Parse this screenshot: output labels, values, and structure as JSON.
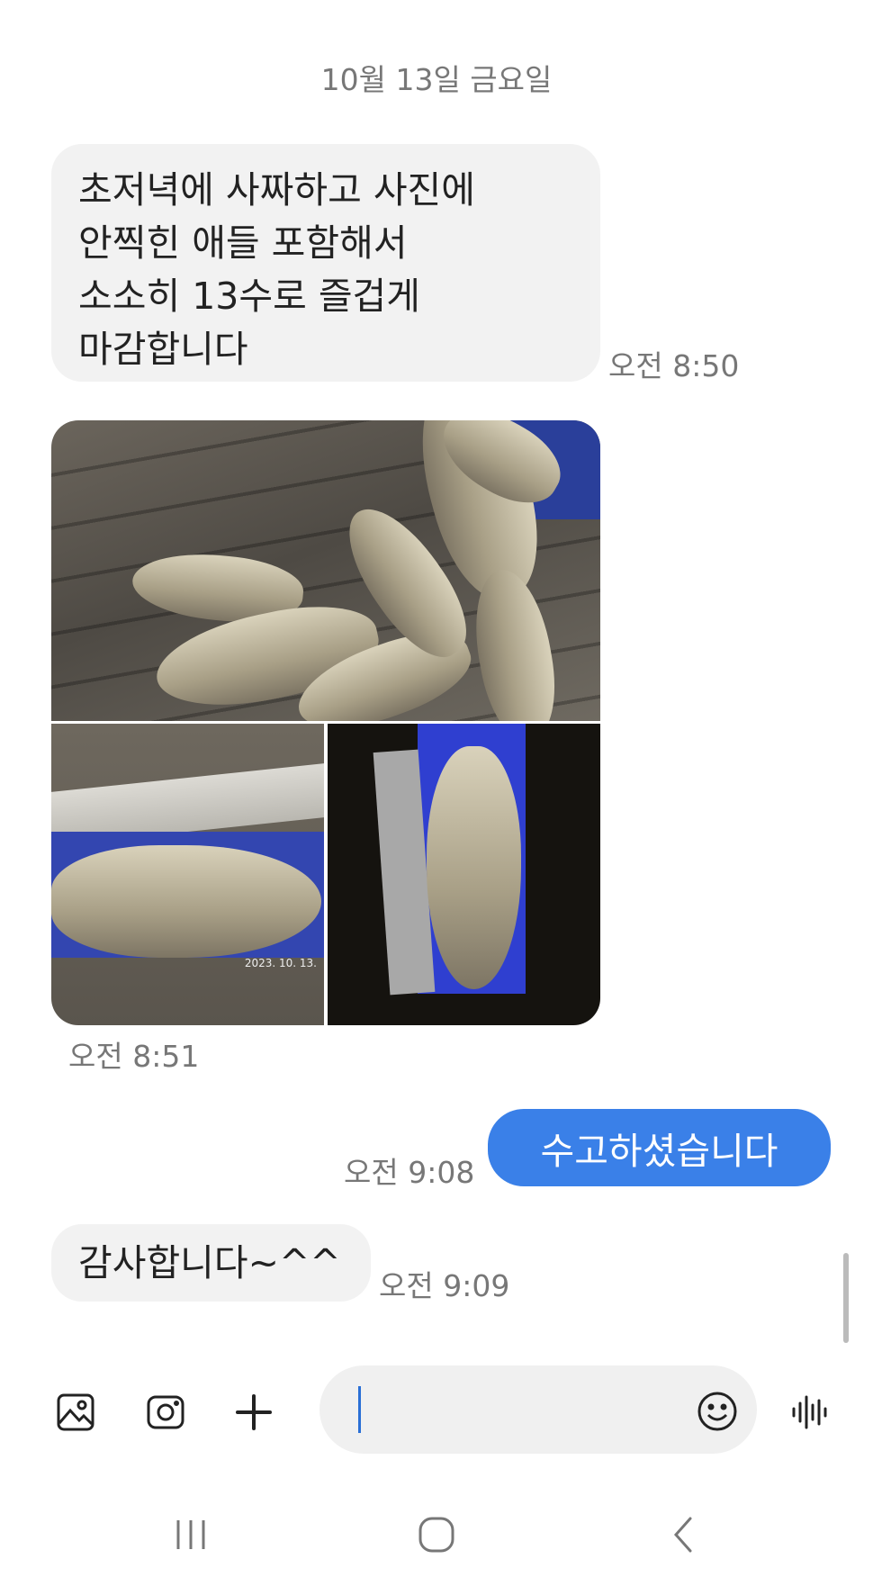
{
  "date_separator": "10월 13일 금요일",
  "messages": [
    {
      "direction": "in",
      "type": "text",
      "lines": [
        "초저녁에 사짜하고 사진에",
        "안찍힌 애들 포함해서",
        "소소히 13수로 즐겁게",
        "마감합니다"
      ],
      "time": "오전 8:50"
    },
    {
      "direction": "in",
      "type": "photos",
      "photo_count": 3,
      "photo_stamp": "2023. 10. 13.",
      "time": "오전 8:51"
    },
    {
      "direction": "out",
      "type": "text",
      "text": "수고하셨습니다",
      "time": "오전 9:08"
    },
    {
      "direction": "in",
      "type": "text",
      "text": "감사합니다~^^",
      "time": "오전 9:09"
    }
  ],
  "composer": {
    "icons": [
      "gallery-icon",
      "camera-icon",
      "plus-icon",
      "emoji-icon",
      "voice-icon"
    ],
    "input_value": ""
  },
  "navbar": {
    "icons": [
      "recent-apps-icon",
      "home-icon",
      "back-icon"
    ]
  },
  "colors": {
    "accent": "#3a80e8",
    "bubble_in": "#f2f2f2",
    "background": "#ffffff"
  }
}
